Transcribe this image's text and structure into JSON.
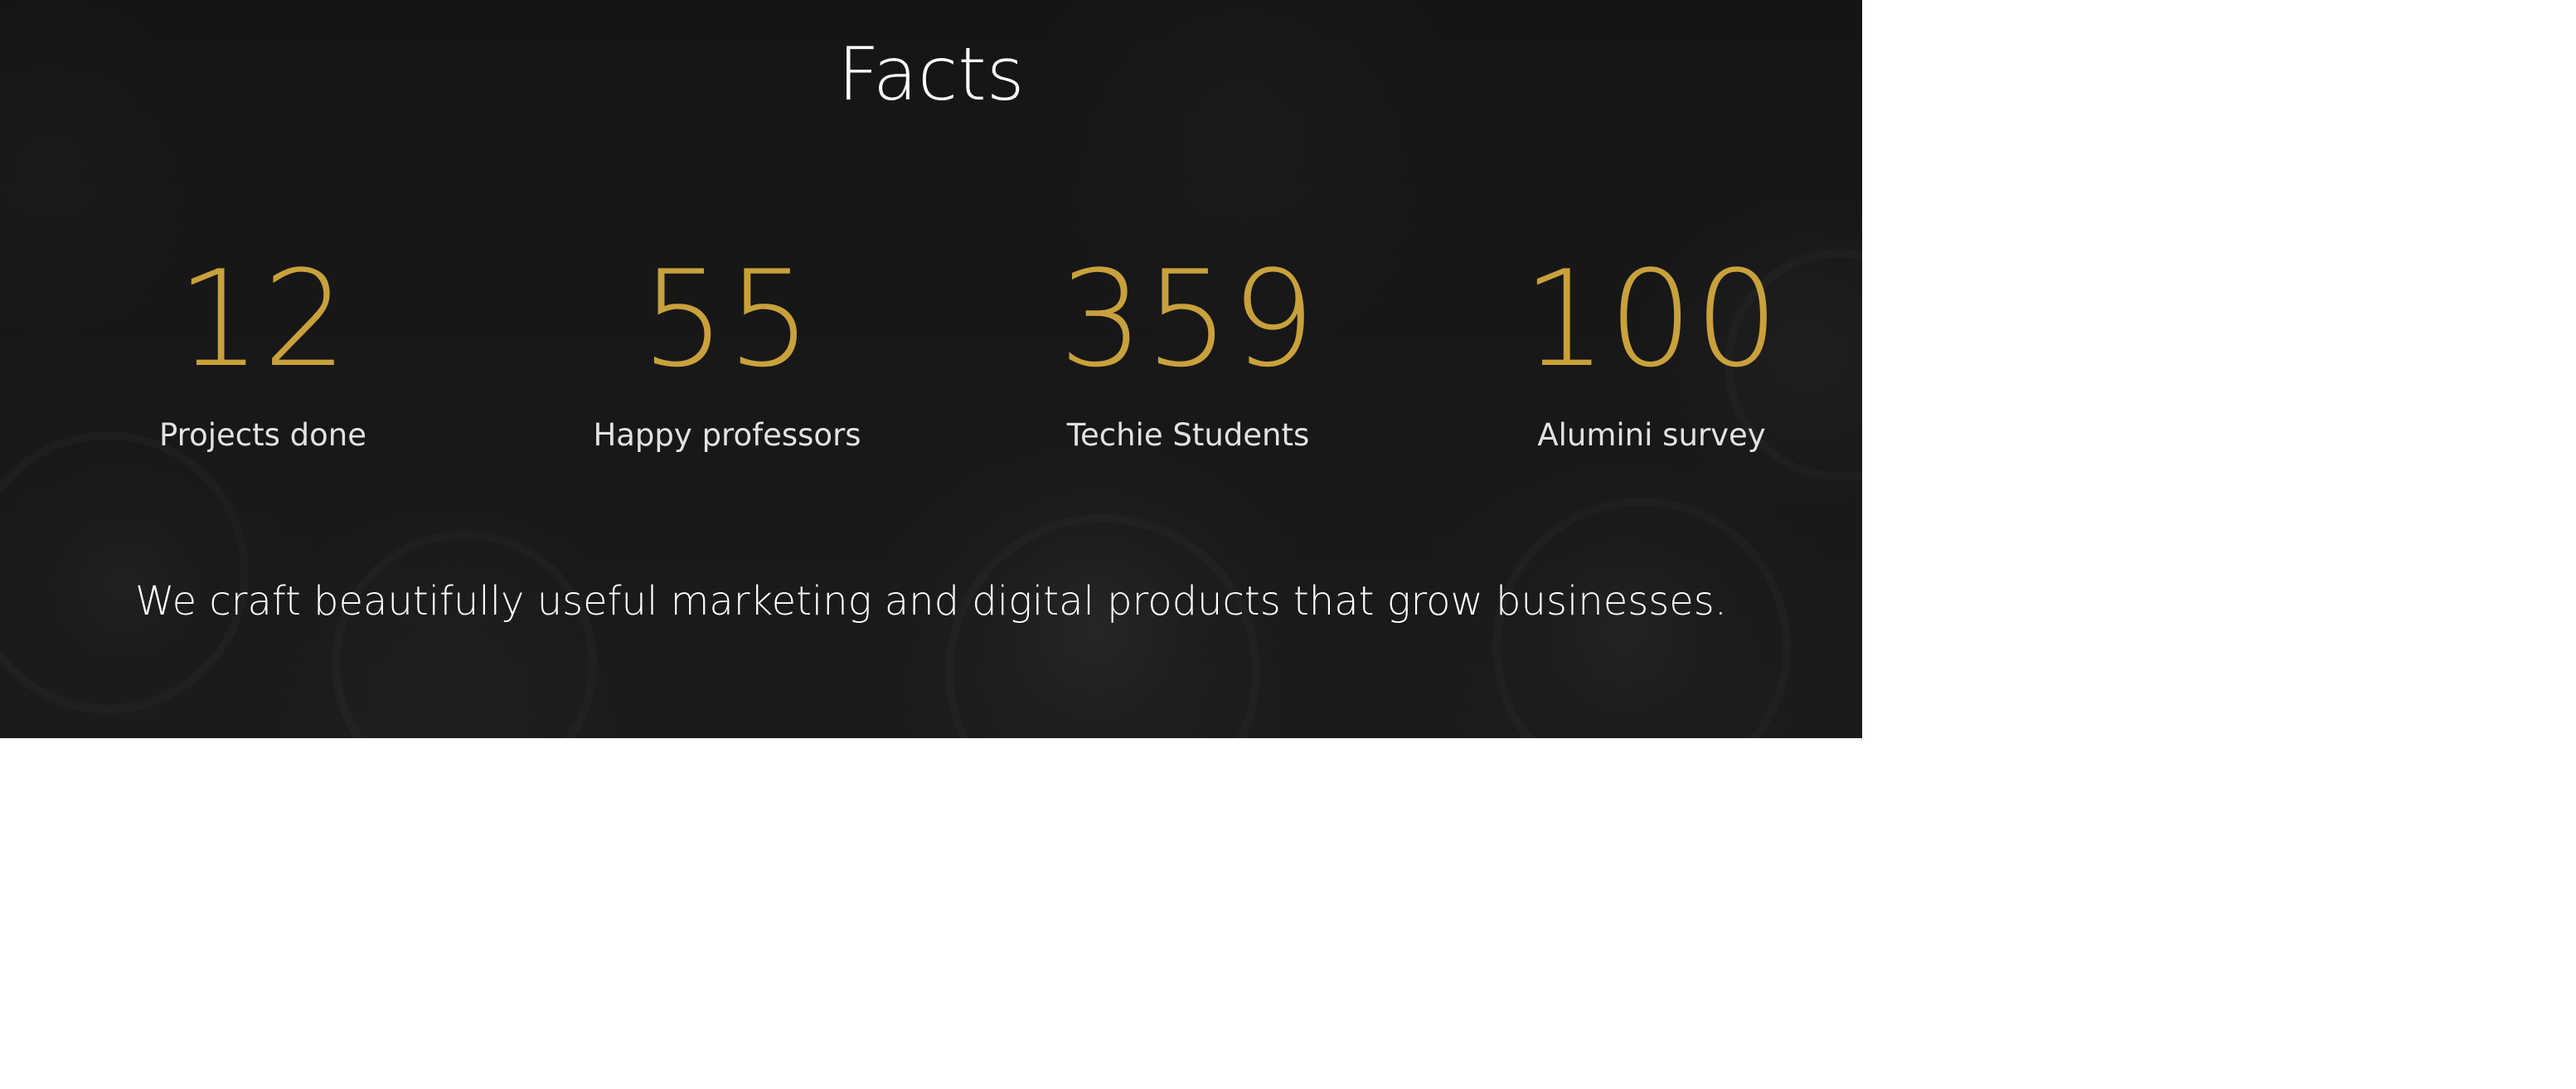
{
  "section": {
    "title": "Facts",
    "tagline": "We craft beautifully useful marketing and digital products that grow businesses."
  },
  "stats": [
    {
      "value": "12",
      "label": "Projects done"
    },
    {
      "value": "55",
      "label": "Happy professors"
    },
    {
      "value": "359",
      "label": "Techie Students"
    },
    {
      "value": "100",
      "label": "Alumini survey"
    }
  ],
  "colors": {
    "background": "#141414",
    "accent": "#c9a13c",
    "title": "#ffffff",
    "label": "#e2e2e2"
  }
}
